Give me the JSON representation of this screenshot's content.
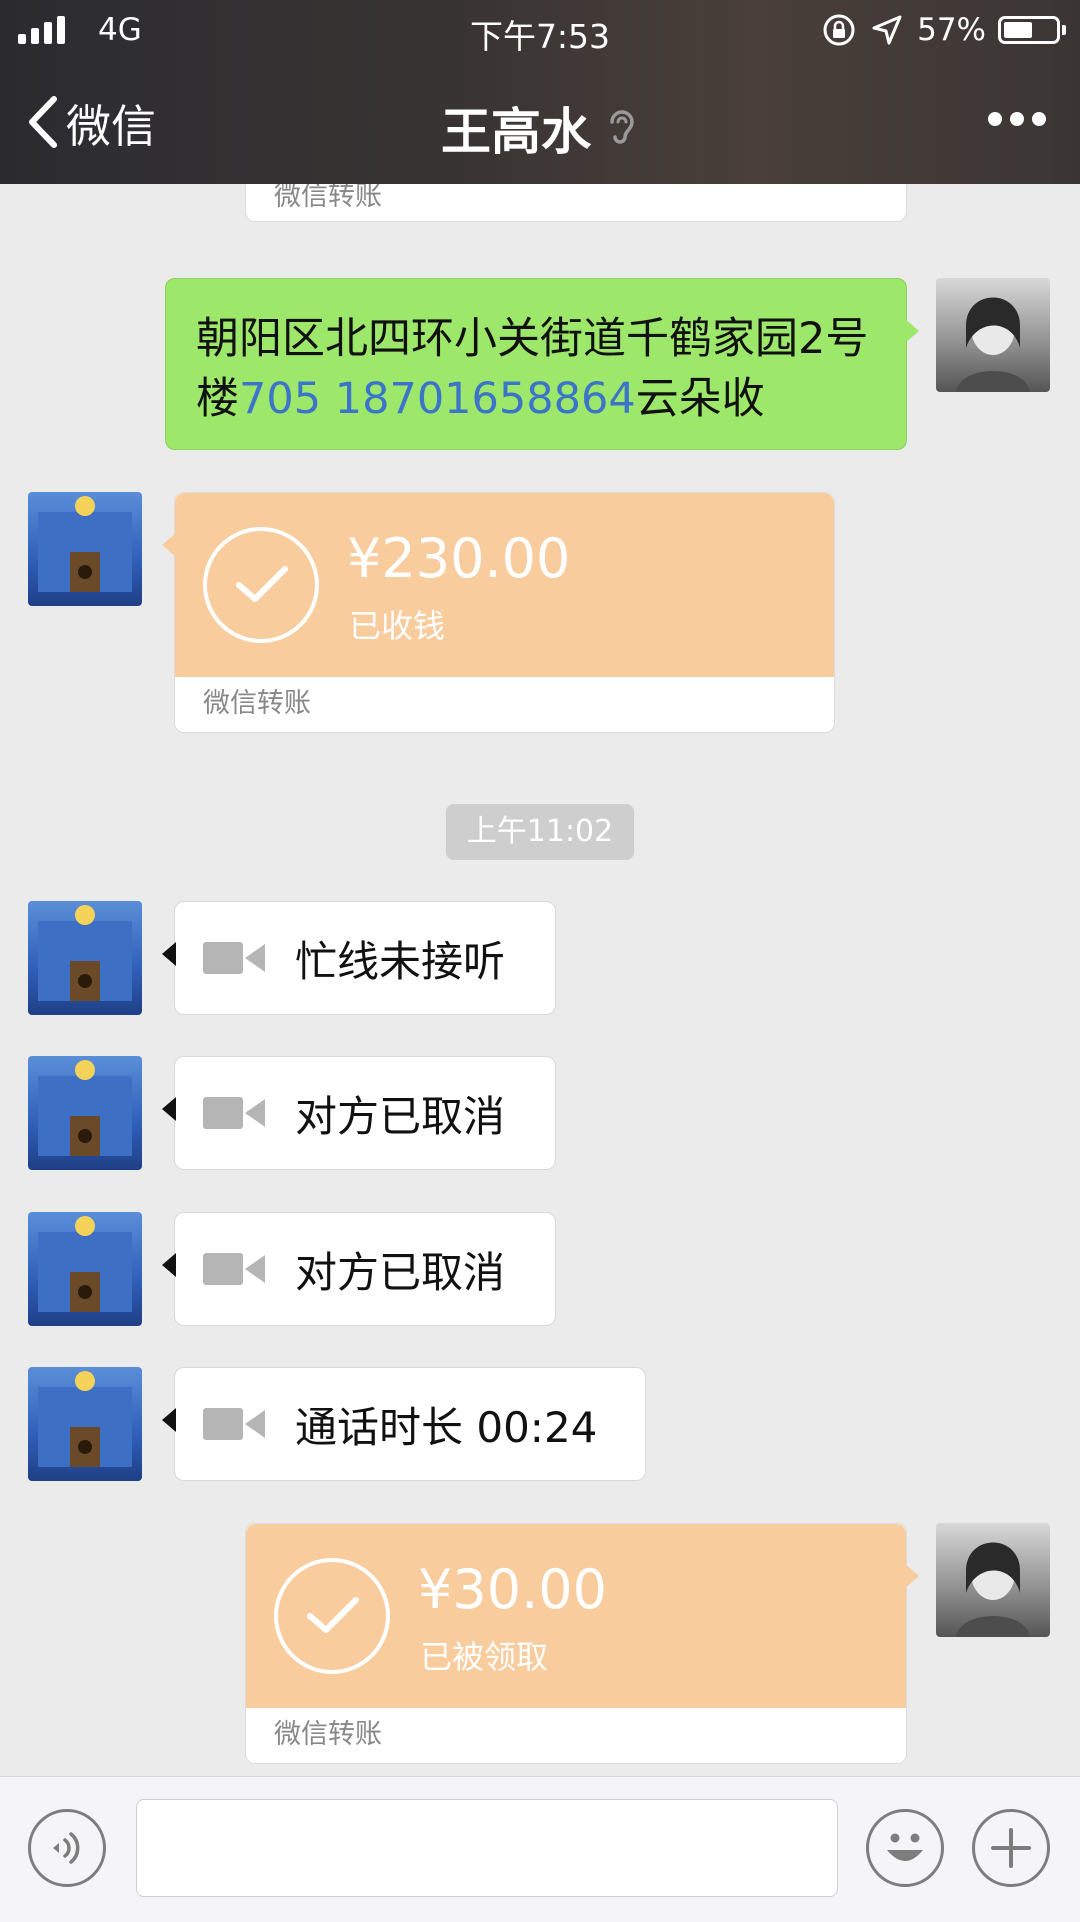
{
  "status_bar": {
    "carrier": "4G",
    "time": "下午7:53",
    "battery_pct": "57%",
    "battery_level": 0.57
  },
  "nav": {
    "back_label": "微信",
    "title": "王高水"
  },
  "messages": {
    "m0_footer": "微信转账",
    "m1": {
      "text_before": "朝阳区北四环小关街道千鹤家园2号楼",
      "link": "705 18701658864",
      "text_after": "云朵收"
    },
    "m2": {
      "amount": "¥230.00",
      "status": "已收钱",
      "footer": "微信转账"
    },
    "timestamp": "上午11:02",
    "m3": "忙线未接听",
    "m4": "对方已取消",
    "m5": "对方已取消",
    "m6": "通话时长 00:24",
    "m7": {
      "amount": "¥30.00",
      "status": "已被领取",
      "footer": "微信转账"
    }
  },
  "icons": {
    "back": "chevron-left-icon",
    "ear": "earpiece-icon",
    "more": "more-dots-icon",
    "voice": "voice-icon",
    "emoji": "emoji-icon",
    "plus": "plus-icon",
    "video": "video-camera-icon"
  },
  "colors": {
    "self_bubble": "#9de76a",
    "transfer": "#f9cc9e",
    "link": "#3b74c9"
  }
}
